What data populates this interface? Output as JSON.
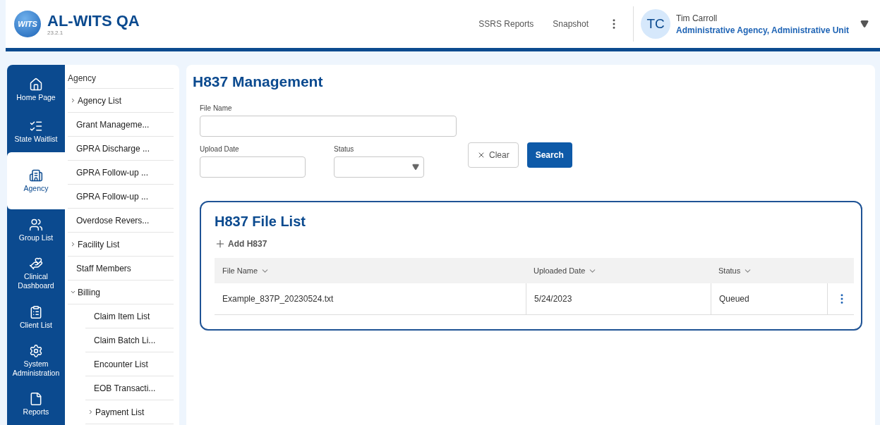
{
  "app": {
    "title": "AL-WITS QA",
    "version": "23.2.1",
    "logo": "WITS"
  },
  "header": {
    "links": [
      "SSRS Reports",
      "Snapshot"
    ],
    "user": {
      "initials": "TC",
      "name": "Tim Carroll",
      "unit": "Administrative Agency, Administrative Unit"
    }
  },
  "nav": [
    {
      "label": "Home Page",
      "selected": false
    },
    {
      "label": "State Waitlist",
      "selected": false
    },
    {
      "label": "Agency",
      "selected": true
    },
    {
      "label": "Group List",
      "selected": false
    },
    {
      "label": "Clinical Dashboard",
      "selected": false
    },
    {
      "label": "Client List",
      "selected": false
    },
    {
      "label": "System Administration",
      "selected": false
    },
    {
      "label": "Reports",
      "selected": false
    }
  ],
  "submenu": {
    "title": "Agency",
    "items": [
      {
        "label": "Agency List",
        "expanded": false
      },
      {
        "label": "Grant Manageme..."
      },
      {
        "label": "GPRA Discharge ..."
      },
      {
        "label": "GPRA Follow-up ..."
      },
      {
        "label": "GPRA Follow-up ..."
      },
      {
        "label": "Overdose Revers..."
      },
      {
        "label": "Facility List",
        "expanded": false
      },
      {
        "label": "Staff Members"
      },
      {
        "label": "Billing",
        "expanded": true,
        "children": [
          {
            "label": "Claim Item List"
          },
          {
            "label": "Claim Batch Li..."
          },
          {
            "label": "Encounter List"
          },
          {
            "label": "EOB Transacti..."
          },
          {
            "label": "Payment List",
            "expanded": false
          }
        ]
      }
    ]
  },
  "page": {
    "title": "H837 Management",
    "filters": {
      "file_name": {
        "label": "File Name"
      },
      "upload_date": {
        "label": "Upload Date"
      },
      "status": {
        "label": "Status"
      }
    },
    "buttons": {
      "clear": "Clear",
      "search": "Search"
    },
    "file_list": {
      "title": "H837 File List",
      "add": "Add H837",
      "columns": [
        "File Name",
        "Uploaded Date",
        "Status"
      ],
      "rows": [
        [
          "Example_837P_20230524.txt",
          "5/24/2023",
          "Queued"
        ]
      ]
    }
  }
}
